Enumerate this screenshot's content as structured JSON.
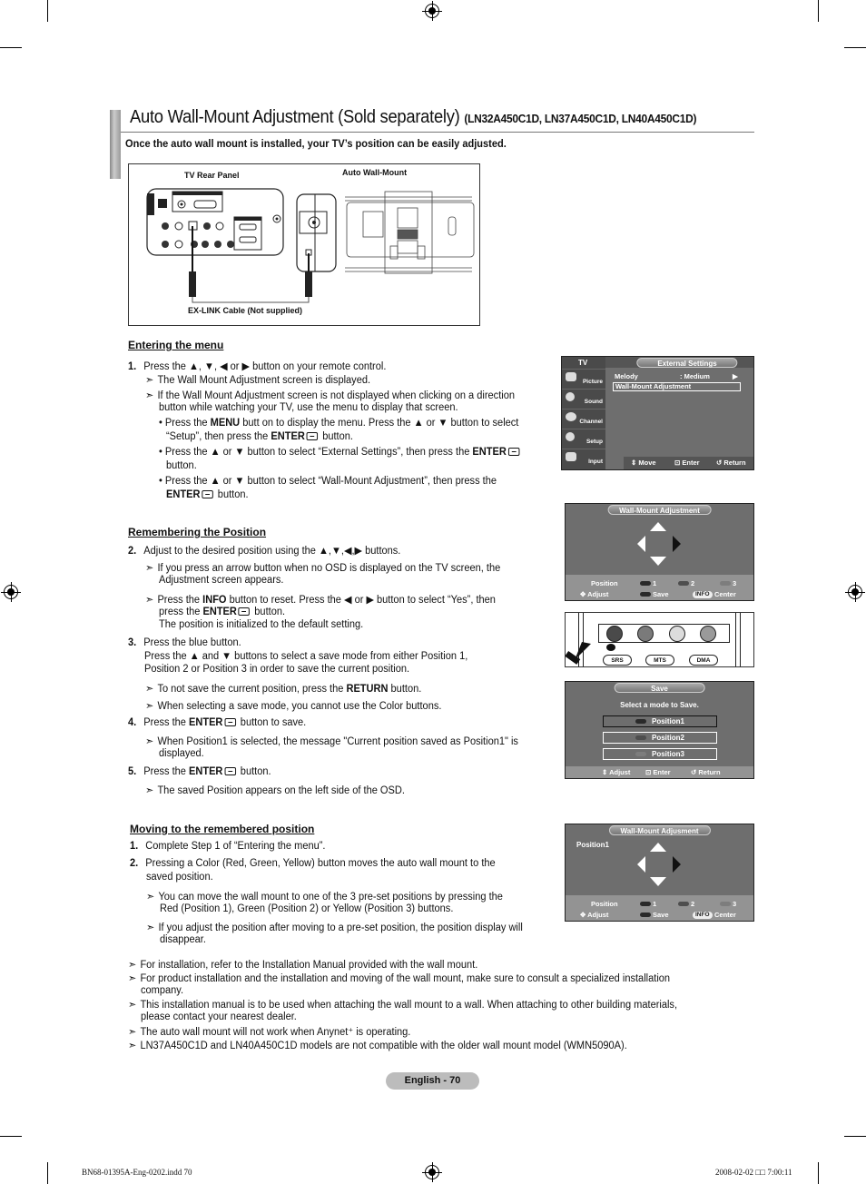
{
  "header": {
    "title": "Auto Wall-Mount Adjustment (Sold separately)",
    "models": "(LN32A450C1D, LN37A450C1D, LN40A450C1D)",
    "intro": "Once the auto wall mount is installed, your TV’s position can be easily adjusted."
  },
  "diagram": {
    "label_rear_panel": "TV Rear Panel",
    "label_wall_mount": "Auto Wall-Mount",
    "label_cable": "EX-LINK Cable (Not supplied)"
  },
  "entering": {
    "heading": "Entering the menu",
    "step1_num": "1.",
    "step1": "Press the ▲, ▼, ◀ or ▶ button on your remote control.",
    "note1": "The Wall Mount Adjustment screen is displayed.",
    "note2_a": "If the Wall Mount Adjustment screen is not displayed when clicking on a direction",
    "note2_b": "button while watching your TV, use the menu to display that screen.",
    "b1_a_pre": "• Press the ",
    "b1_a_bold": "MENU",
    "b1_a_post": " butt on to display the menu. Press the ▲ or ▼ button to select",
    "b1_b_pre": "“Setup”, then press the ",
    "b1_b_bold": "ENTER",
    "b1_b_post": " button.",
    "b2_a_pre": "• Press the ▲ or ▼ button to select “External Settings”, then press the ",
    "b2_a_bold": "ENTER",
    "b2_b": "button.",
    "b3_a": "• Press the ▲ or ▼ button to select “Wall-Mount Adjustment”, then press the",
    "b3_b_bold": "ENTER",
    "b3_b_post": " button."
  },
  "remembering": {
    "heading": "Remembering the Position",
    "s2_num": "2.",
    "s2": "Adjust to the desired position using the ▲,▼,◀,▶ buttons.",
    "n1_a": "If you press an arrow button when no OSD is displayed on the TV screen, the",
    "n1_b": "Adjustment screen appears.",
    "n2_a_pre": "Press the ",
    "n2_a_bold": "INFO",
    "n2_a_post": " button to reset. Press the ◀ or ▶ button to select “Yes”, then",
    "n2_b_pre": "press the ",
    "n2_b_bold": "ENTER",
    "n2_b_post": " button.",
    "n2_c": "The position is initialized to the default setting.",
    "s3_num": "3.",
    "s3_a": "Press the blue button.",
    "s3_b": "Press the ▲ and ▼ buttons to select a save mode from either Position 1,",
    "s3_c": "Position 2 or Position 3 in order to save the current position.",
    "n3_pre": "To not save the current position, press the ",
    "n3_bold": "RETURN",
    "n3_post": " button.",
    "n4": "When selecting a save mode, you cannot use the Color buttons.",
    "s4_num": "4.",
    "s4_pre": "Press the ",
    "s4_bold": "ENTER",
    "s4_post": " button to save.",
    "n5_a": "When Position1 is selected, the message \"Current position saved as Position1\" is",
    "n5_b": "displayed.",
    "s5_num": "5.",
    "s5_pre": "Press the ",
    "s5_bold": "ENTER",
    "s5_post": " button.",
    "n6": "The saved Position appears on the left side of the OSD."
  },
  "moving": {
    "heading": "Moving to the remembered position",
    "s1_num": "1.",
    "s1": "Complete Step 1 of “Entering the menu”.",
    "s2_num": "2.",
    "s2_a": "Pressing a Color (Red, Green, Yellow) button moves the auto wall mount to the",
    "s2_b": "saved position.",
    "n1_a": "You can move the wall mount to one of the 3 pre-set positions by pressing the",
    "n1_b": "Red (Position 1), Green (Position 2) or Yellow (Position 3) buttons.",
    "n2_a": "If you adjust the position after moving to a pre-set position, the position display will",
    "n2_b": "disappear."
  },
  "notes": [
    "For installation, refer to the Installation Manual provided with the wall mount.",
    "For product installation and the installation and moving of the wall mount, make sure to consult a specialized installation",
    "company.",
    "This installation manual is to be used when attaching the wall mount to a wall. When attaching to other building materials,",
    "please contact your nearest dealer.",
    "The auto wall mount will not work when Anynet⁺ is operating.",
    "LN37A450C1D and LN40A450C1D models are not compatible with the older wall mount model (WMN5090A)."
  ],
  "osd_menu": {
    "tv_label": "TV",
    "caption": "External Settings",
    "sidebar": [
      "Picture",
      "Sound",
      "Channel",
      "Setup",
      "Input"
    ],
    "row1_label": "Melody",
    "row1_value": ": Medium",
    "row1_arrow": "▶",
    "row2_label": "Wall-Mount Adjustment",
    "hint_move": "Move",
    "hint_enter": "Enter",
    "hint_return": "Return"
  },
  "osd_adjust": {
    "caption": "Wall-Mount Adjustment",
    "position_label": "Position",
    "p1": "1",
    "p2": "2",
    "p3": "3",
    "adjust": "Adjust",
    "save": "Save",
    "info": "INFO",
    "center": "Center"
  },
  "remote": {
    "srs": "SRS",
    "mts": "MTS",
    "dma": "DMA",
    "button_colors": [
      "#4a4a4a",
      "#7a7a7a",
      "#dcdcdc",
      "#9a9a9a"
    ]
  },
  "osd_save": {
    "caption": "Save",
    "prompt": "Select a mode to Save.",
    "options": [
      "Position1",
      "Position2",
      "Position3"
    ],
    "selected": "Position1",
    "hint_adjust": "Adjust",
    "hint_enter": "Enter",
    "hint_return": "Return"
  },
  "osd_adjust2": {
    "caption": "Wall-Mount Adjusment",
    "saved_position": "Position1",
    "position_label": "Position",
    "p1": "1",
    "p2": "2",
    "p3": "3",
    "adjust": "Adjust",
    "save": "Save",
    "info": "INFO",
    "center": "Center"
  },
  "footer": {
    "page_label": "English - 70",
    "slug_left": "BN68-01395A-Eng-0202.indd   70",
    "slug_right": "2008-02-02   □□ 7:00:11"
  },
  "colors": {
    "osd_bg": "#6e6e6e",
    "osd_bar": "#939393",
    "pill_bg": "#bcbcbc",
    "position_pill_1": "#2a2a2a",
    "position_pill_2": "#4e4e4e",
    "position_pill_3": "#7d7d7d"
  }
}
